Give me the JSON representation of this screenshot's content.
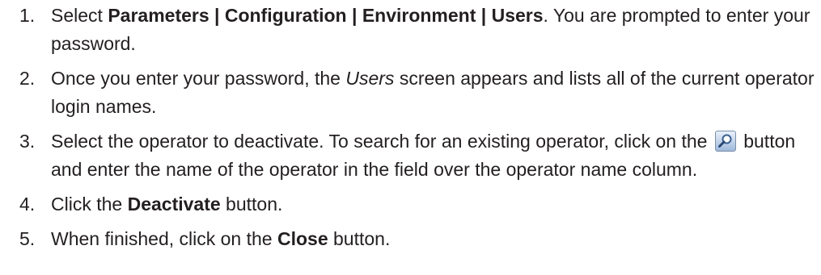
{
  "steps": [
    {
      "number": "1.",
      "pre": "Select ",
      "bold": "Parameters | Configuration | Environment | Users",
      "post": ". You are prompted to enter your password."
    },
    {
      "number": "2.",
      "pre": "Once you enter your password, the ",
      "italic": "Users",
      "post": " screen appears and lists all of the current operator login names."
    },
    {
      "number": "3.",
      "pre": "Select the operator to deactivate. To search for an existing operator, click on the ",
      "icon": "magnifier-search-icon",
      "post": " button and enter the name of the operator in the field over the operator name column."
    },
    {
      "number": "4.",
      "pre": "Click the ",
      "bold": "Deactivate",
      "post": " button."
    },
    {
      "number": "5.",
      "pre": "When finished, click on the ",
      "bold": "Close",
      "post": " button."
    }
  ]
}
